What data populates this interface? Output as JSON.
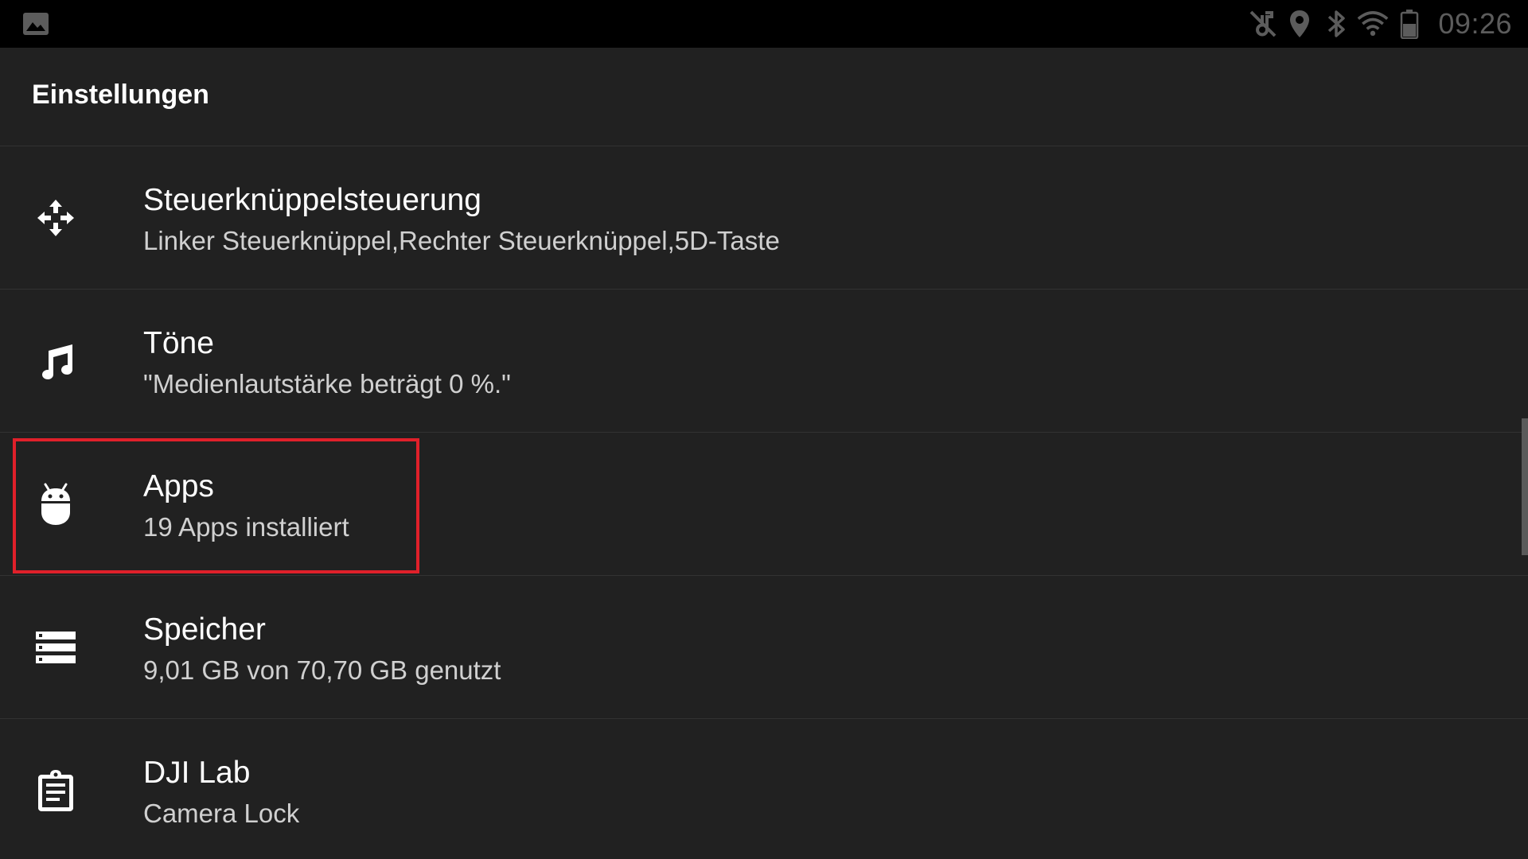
{
  "status_bar": {
    "time": "09:26",
    "icons": [
      "image-icon",
      "music-off-icon",
      "location-icon",
      "bluetooth-icon",
      "wifi-icon",
      "battery-icon"
    ]
  },
  "app_bar": {
    "title": "Einstellungen"
  },
  "settings": {
    "items": [
      {
        "icon": "move-arrows-icon",
        "title": "Steuerknüppelsteuerung",
        "subtitle": "Linker Steuerknüppel,Rechter Steuerknüppel,5D-Taste"
      },
      {
        "icon": "music-note-icon",
        "title": "Töne",
        "subtitle": "\"Medienlautstärke beträgt 0 %.\""
      },
      {
        "icon": "android-icon",
        "title": "Apps",
        "subtitle": "19 Apps installiert",
        "highlighted": true
      },
      {
        "icon": "storage-icon",
        "title": "Speicher",
        "subtitle": "9,01 GB von 70,70 GB genutzt"
      },
      {
        "icon": "clipboard-icon",
        "title": "DJI Lab",
        "subtitle": "Camera Lock"
      }
    ]
  },
  "colors": {
    "background": "#212121",
    "status_bar": "#000000",
    "highlight_border": "#e0202a",
    "text_primary": "#ffffff",
    "text_secondary": "#d0d0d0"
  }
}
